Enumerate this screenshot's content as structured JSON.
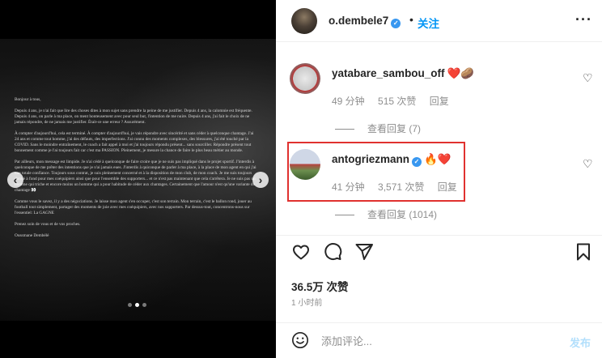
{
  "post": {
    "author": "o.dembele7",
    "separator": "•",
    "follow_label": "关注",
    "more_icon": "more-horizontal-icon"
  },
  "letter": {
    "paragraphs": [
      "Bonjour à tous,",
      "Depuis 4 ans, je n'ai fait que lire des choses dites à mon sujet sans prendre la peine de me justifier. Depuis 4 ans, la calomnie est fréquente. Depuis 4 ans, on parle à ma place, on ment honteusement avec pour seul but, l'intention de me nuire. Depuis 4 ans, j'ai fait le choix de ne jamais répondre, de ne jamais me justifier. Était-ce une erreur ? Assurément.",
      "À compter d'aujourd'hui, cela est terminé. À compter d'aujourd'hui, je vais répondre avec sincérité et sans céder à quelconque chantage. J'ai 24 ans et comme tout homme, j'ai des défauts, des imperfections. J'ai connu des moments complexes, des blessures, j'ai été touché par la COVID. Sans le moindre entraînement, le coach a fait appel à moi et j'ai toujours répondu présent... sans sourciller. Répondre présent tout bonnement comme je l'ai toujours fait car c'est ma PASSION. Pleinement, je mesure la chance de faire le plus beau métier au monde.",
      "Par ailleurs, mon message est limpide. Je n'ai cédé à quelconque de faire croire que je ne suis pas impliqué dans le projet sportif. J'interdis à quelconque de me prêter des intentions que je n'ai jamais eues. J'interdis à quiconque de parler à ma place, à la place de mon agent en qui j'ai une totale confiance. Toujours sous contrat, je suis pleinement concerné et à la disposition de mon club, de mon coach. Je me suis toujours donné à fond pour mes coéquipiers ainsi que pour l'ensemble des supporters... et ce n'est pas maintenant que cela s'arrêtera. Je ne suis pas un homme qui triche et encore moins un homme qui a pour habitude de céder aux chantages. Certainement que l'amour n'est qu'une variante du chantage 👀",
      "Comme vous le savez, il y a des négociations. Je laisse mon agent s'en occuper, c'est son terrain. Mon terrain, c'est le ballon rond, jouer au football tout simplement, partager des moments de joie avec mes coéquipiers, avec nos supporters. Par dessus-tout, concentrons-nous sur l'essentiel: La GAGNE",
      "Prenez soin de vous et de vos proches.",
      "Oussmane Dembélé"
    ]
  },
  "comments": [
    {
      "username": "yatabare_sambou_off",
      "emoji": "❤️🥔",
      "time": "49 分钟",
      "likes": "515 次赞",
      "reply_label": "回复",
      "view_replies": "查看回复 (7)"
    },
    {
      "username": "antogriezmann",
      "emoji": "🔥❤️",
      "time": "41 分钟",
      "likes": "3,571 次赞",
      "reply_label": "回复",
      "view_replies": "查看回复 (1014)"
    }
  ],
  "stats": {
    "likes": "36.5万 次赞",
    "time_ago": "1 小时前"
  },
  "composer": {
    "placeholder": "添加评论...",
    "post_label": "发布"
  },
  "colors": {
    "accent": "#0095f6",
    "highlight": "#e0312f",
    "verified": "#3897f0"
  }
}
